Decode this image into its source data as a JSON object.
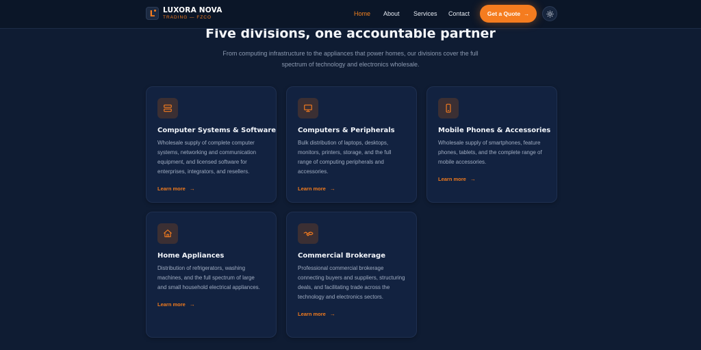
{
  "header": {
    "logo_letter": "L",
    "brand_name": "LUXORA NOVA",
    "brand_sub": "TRADING — FZCO",
    "nav": [
      {
        "label": "Home",
        "active": true
      },
      {
        "label": "About",
        "active": false
      },
      {
        "label": "Services",
        "active": false
      },
      {
        "label": "Contact",
        "active": false
      }
    ],
    "cta_label": "Get a Quote",
    "cta_arrow": "→",
    "theme_icon": "sun-icon"
  },
  "section": {
    "title": "Five divisions, one accountable partner",
    "subtitle": "From computing infrastructure to the appliances that power homes, our divisions cover the full spectrum of technology and electronics wholesale."
  },
  "cards": [
    {
      "icon": "server-icon",
      "title": "Computer Systems & Software",
      "desc": "Wholesale supply of complete computer systems, networking and communication equipment, and licensed software for enterprises, integrators, and resellers.",
      "link": "Learn more",
      "arrow": "→"
    },
    {
      "icon": "monitor-icon",
      "title": "Computers & Peripherals",
      "desc": "Bulk distribution of laptops, desktops, monitors, printers, storage, and the full range of computing peripherals and accessories.",
      "link": "Learn more",
      "arrow": "→"
    },
    {
      "icon": "smartphone-icon",
      "title": "Mobile Phones & Accessories",
      "desc": "Wholesale supply of smartphones, feature phones, tablets, and the complete range of mobile accessories.",
      "link": "Learn more",
      "arrow": "→"
    },
    {
      "icon": "home-icon",
      "title": "Home Appliances",
      "desc": "Distribution of refrigerators, washing machines, and the full spectrum of large and small household electrical appliances.",
      "link": "Learn more",
      "arrow": "→"
    },
    {
      "icon": "handshake-icon",
      "title": "Commercial Brokerage",
      "desc": "Professional commercial brokerage connecting buyers and suppliers, structuring deals, and facilitating trade across the technology and electronics sectors.",
      "link": "Learn more",
      "arrow": "→"
    }
  ],
  "colors": {
    "accent": "#f57c1f",
    "background": "#0f1c33",
    "card": "#122240"
  }
}
